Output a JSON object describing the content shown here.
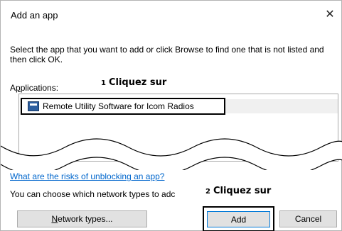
{
  "dialog": {
    "title": "Add an app",
    "close_glyph": "✕",
    "description": "Select the app that you want to add or click Browse to find one that is not listed and then click OK.",
    "applications_label_prefix": "A",
    "applications_label_accel": "p",
    "applications_label_rest": "plications:",
    "apps": [
      {
        "label": "Remote Utility Software for Icom Radios",
        "icon": "app-icon",
        "selected": true
      }
    ],
    "risk_link": "What are the risks of unblocking an app?",
    "network_text": "You can choose which network types to adc",
    "buttons": {
      "network_accel": "N",
      "network_rest": "etwork types...",
      "add": "Add",
      "cancel": "Cancel"
    }
  },
  "callouts": [
    {
      "num": "1",
      "text": "Cliquez sur"
    },
    {
      "num": "2",
      "text": "Cliquez sur"
    }
  ],
  "colors": {
    "link": "#0066cc",
    "focus_border": "#0078d7",
    "button_bg": "#e1e1e1"
  }
}
